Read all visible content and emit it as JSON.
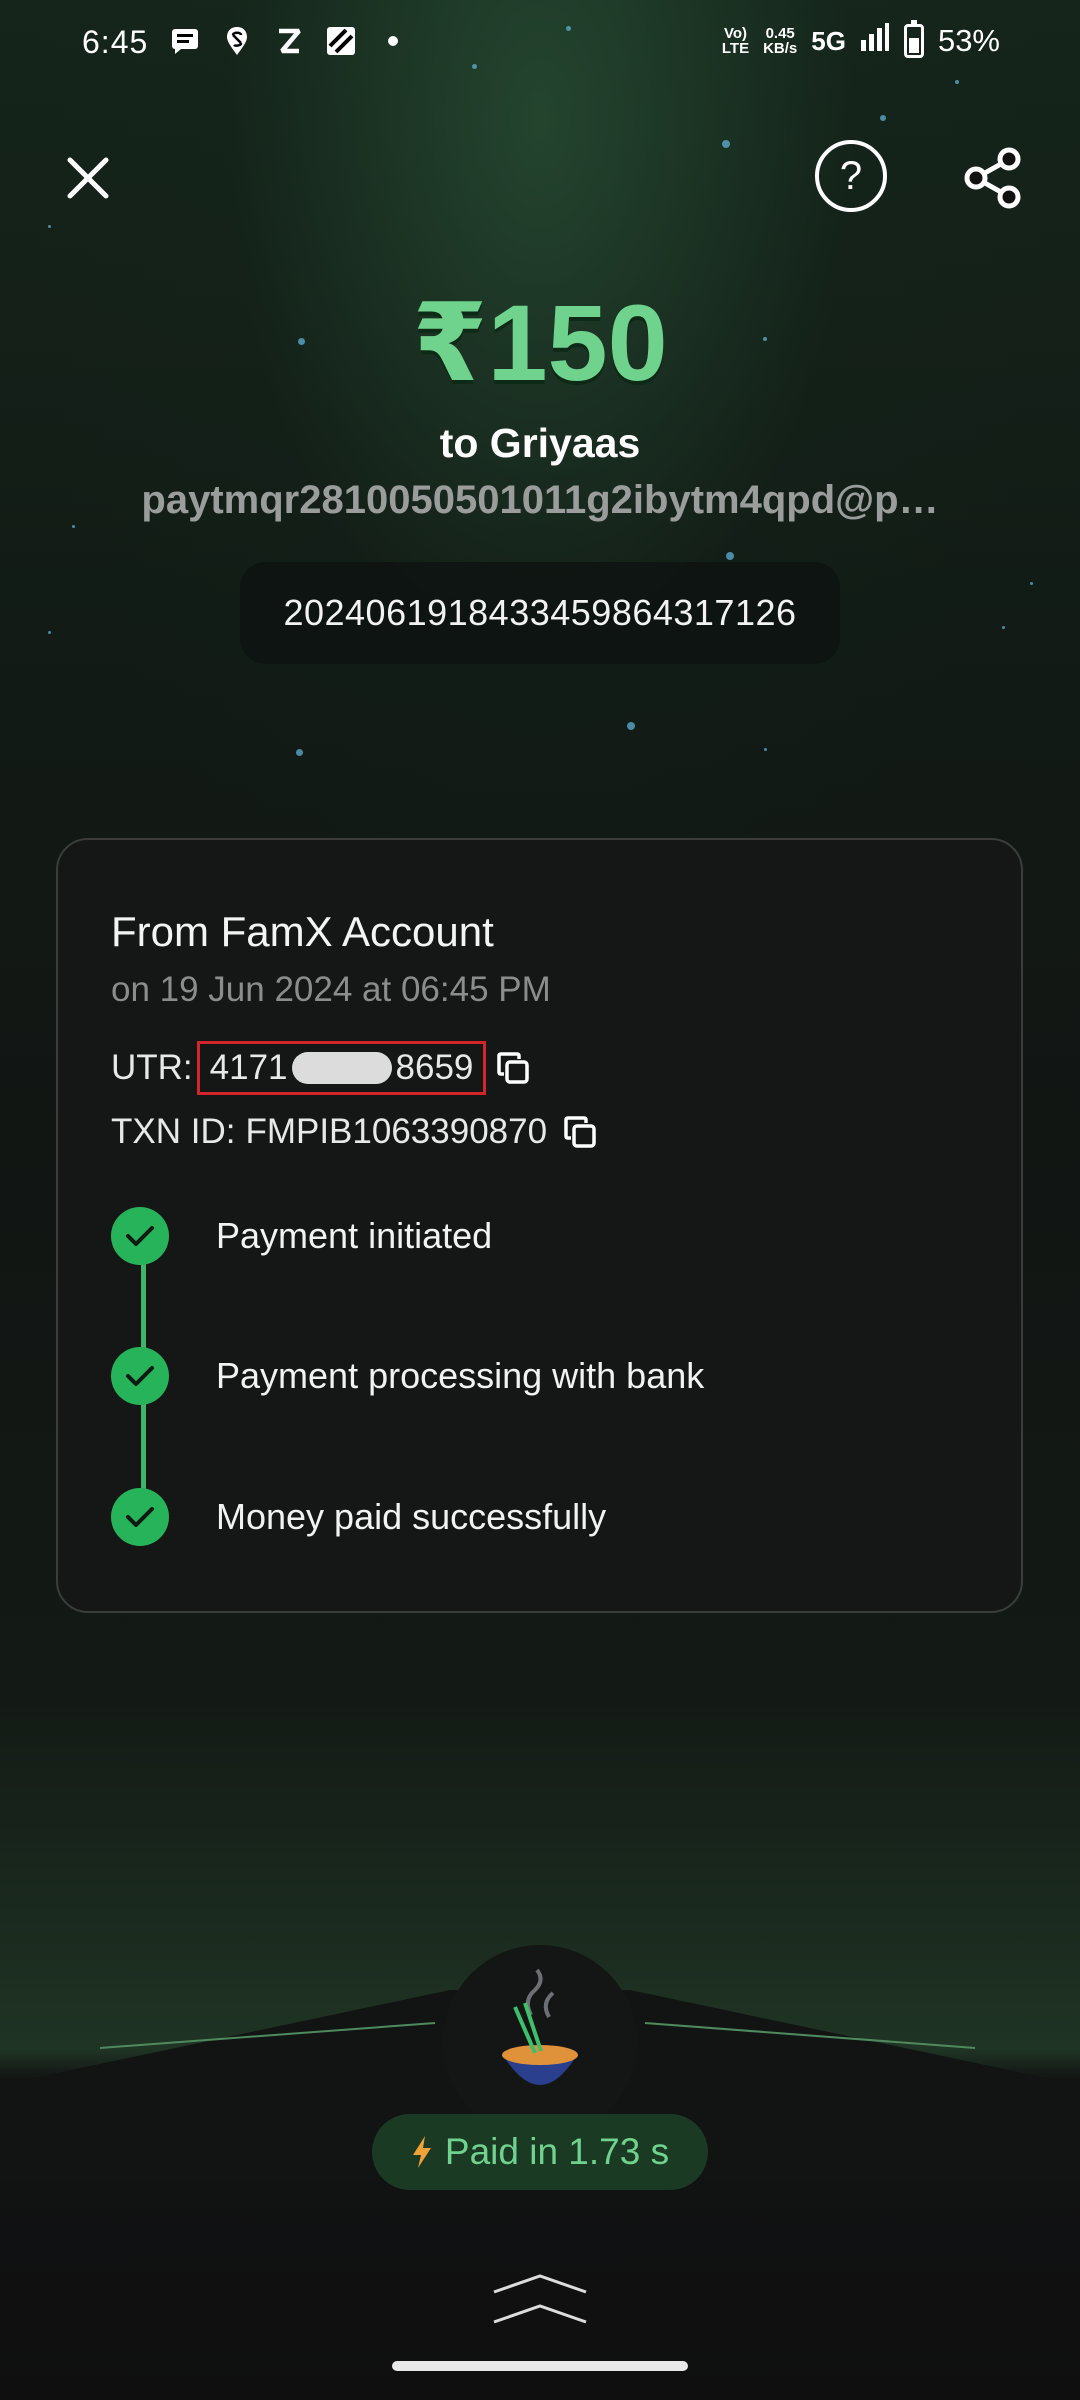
{
  "status_bar": {
    "time": "6:45",
    "left_icons": [
      "message-icon",
      "swiggy-icon",
      "zomato-icon",
      "slice-icon",
      "dot-icon"
    ],
    "volte": "Vo) LTE",
    "speed": "0.45",
    "speed_unit": "KB/s",
    "network": "5G",
    "battery": "53%"
  },
  "header": {
    "help_symbol": "?"
  },
  "payment": {
    "amount": "₹150",
    "payee": "to Griyaas",
    "vpa": "paytmqr2810050501011g2ibytm4qpd@p…",
    "reference": "20240619184334598643171​26"
  },
  "card": {
    "from": "From FamX Account",
    "datetime": "on 19 Jun 2024 at 06:45 PM",
    "utr_label": "UTR:",
    "utr_prefix": "4171",
    "utr_suffix": "8659",
    "txn_label": "TXN ID:",
    "txn_id": "FMPIB1063390870",
    "steps": [
      {
        "label": "Payment initiated"
      },
      {
        "label": "Payment processing with bank"
      },
      {
        "label": "Money paid successfully"
      }
    ]
  },
  "footer": {
    "paid_text": "Paid in 1.73 s"
  },
  "colors": {
    "accent_green": "#6fd28d",
    "check_green": "#27b35a",
    "highlight_red": "#d2262c"
  }
}
